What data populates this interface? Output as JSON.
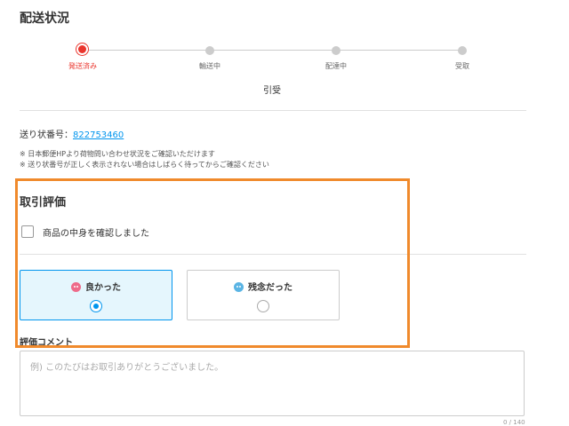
{
  "header": {
    "title": "配送状況"
  },
  "progress": {
    "steps": [
      {
        "label": "発送済み",
        "active": true
      },
      {
        "label": "輸送中",
        "active": false
      },
      {
        "label": "配達中",
        "active": false
      },
      {
        "label": "受取",
        "active": false
      }
    ],
    "current_status": "引受"
  },
  "tracking": {
    "label": "送り状番号：",
    "number": "822753460"
  },
  "notes": [
    "※ 日本郵便HPより荷物問い合わせ状況をご確認いただけます",
    "※ 送り状番号が正しく表示されない場合はしばらく待ってからご確認ください"
  ],
  "evaluation": {
    "title": "取引評価",
    "checkbox_label": "商品の中身を確認しました",
    "options": [
      {
        "label": "良かった",
        "icon": "smile-face-icon",
        "selected": true
      },
      {
        "label": "残念だった",
        "icon": "sad-face-icon",
        "selected": false
      }
    ],
    "comment_label": "評価コメント",
    "comment_placeholder": "例) このたびはお取引ありがとうございました。",
    "counter": "0 / 140"
  },
  "colors": {
    "accent_red": "#ea352d",
    "link_blue": "#0095ee",
    "selected_bg": "#e5f6fd",
    "highlight_orange": "#f08a2c"
  }
}
